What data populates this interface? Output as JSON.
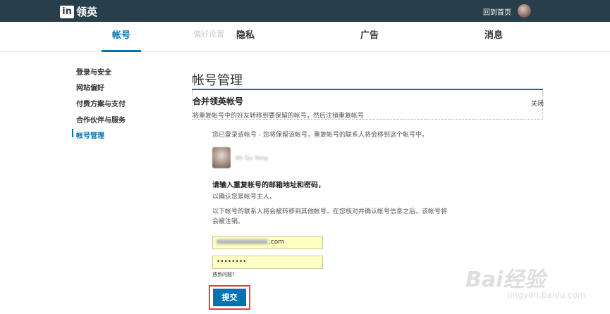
{
  "header": {
    "logo_mark": "in",
    "logo_text": "领英",
    "home_link": "回到首页"
  },
  "nav": {
    "tabs": [
      {
        "label": "帐号",
        "active": true
      },
      {
        "label": "隐私",
        "active": false
      },
      {
        "label": "广告",
        "active": false
      },
      {
        "label": "消息",
        "active": false
      }
    ],
    "ghost_text": "偏好设置"
  },
  "sidebar": {
    "items": [
      {
        "label": "登录与安全",
        "active": false
      },
      {
        "label": "网站偏好",
        "active": false
      },
      {
        "label": "付费方案与支付",
        "active": false
      },
      {
        "label": "合作伙伴与服务",
        "active": false
      },
      {
        "label": "帐号管理",
        "active": true
      }
    ]
  },
  "main": {
    "page_title": "帐号管理",
    "card": {
      "title": "合并领英帐号",
      "close_label": "关闭",
      "subtitle": "将重复帐号中的好友转移到要保留的帐号，然后注销重复帐号"
    },
    "info_line": "您已登录该帐号 - 您将保留该帐号，重复帐号的联系人将会移到这个帐号中。",
    "person_name": "Ah Gu Yong",
    "prompt_bold": "请输入重复帐号的邮箱地址和密码，",
    "prompt_sub": "以确认您是帐号主人。",
    "notice": "以下帐号的联系人将会被转移到其他帐号。在您核对并确认帐号信息之后，该帐号将会被注销。",
    "email_suffix": ".com",
    "password_mask": "••••••••",
    "problem_link": "遇到问题?",
    "submit_label": "提交"
  },
  "watermark": {
    "brand": "Bai经验",
    "url": "jingyan.baidu.com"
  },
  "colors": {
    "topbar": "#283e4a",
    "accent": "#0073b1",
    "field_bg": "#ffffc4",
    "highlight": "#e0433a"
  }
}
